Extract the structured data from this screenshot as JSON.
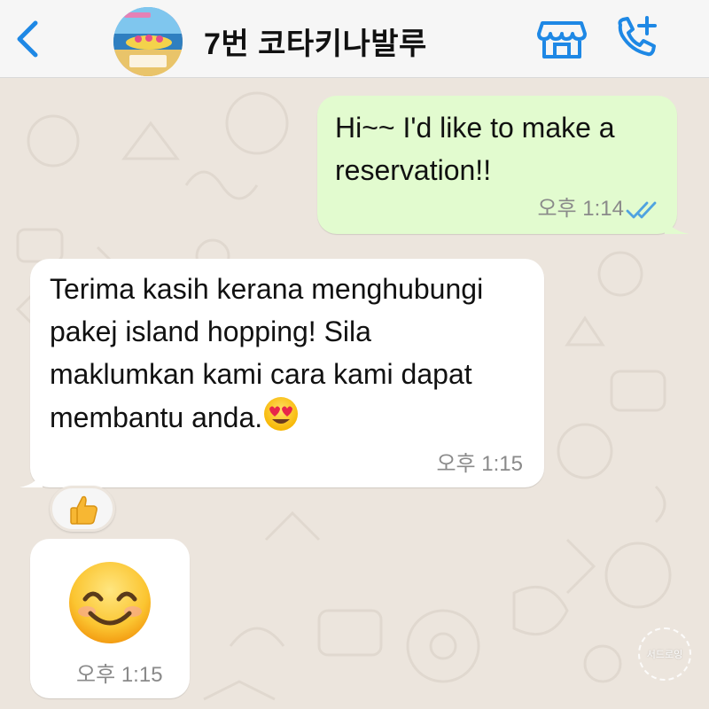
{
  "header": {
    "title": "7번 코타키나발루",
    "back_icon": "chevron-left-icon",
    "store_icon": "storefront-icon",
    "call_icon": "add-call-icon",
    "accent_color": "#1e88e5"
  },
  "messages": [
    {
      "direction": "outgoing",
      "text": "Hi~~ I'd like to make a reservation!!",
      "time": "오후 1:14",
      "status_icon": "double-check-read-icon"
    },
    {
      "direction": "incoming",
      "text": "Terima kasih kerana menghubungi pakej island hopping! Sila maklumkan kami cara kami dapat membantu anda.",
      "emoji": "smiling-face-with-heart-eyes",
      "time": "오후 1:15",
      "reaction": "thumbs-up"
    },
    {
      "direction": "incoming",
      "emoji": "smiling-face-with-smiling-eyes",
      "time": "오후 1:15"
    }
  ],
  "watermark": {
    "text": "서드로잉"
  },
  "colors": {
    "outgoing_bubble": "#e2fbcf",
    "incoming_bubble": "#ffffff",
    "wallpaper": "#ece5dd",
    "read_ticks": "#4fa3e0"
  }
}
